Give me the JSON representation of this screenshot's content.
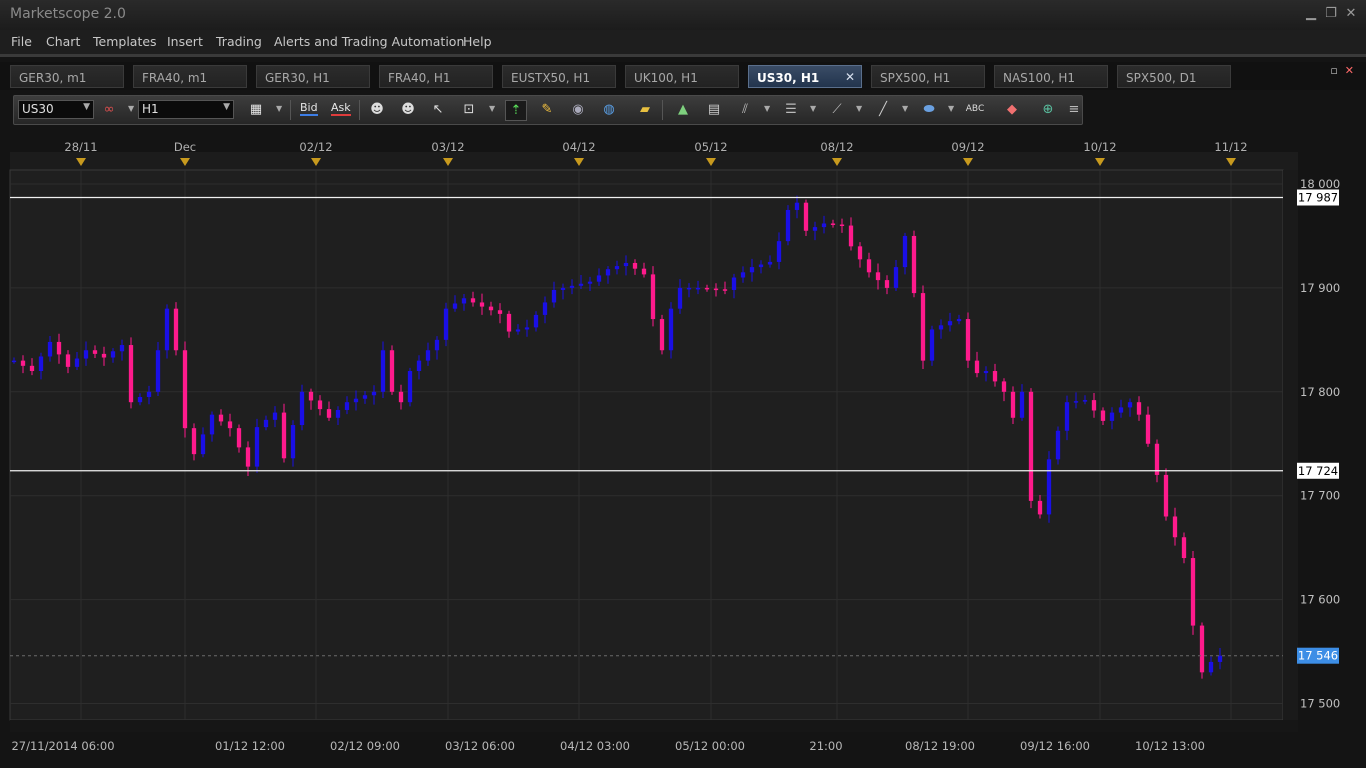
{
  "app": {
    "title": "Marketscope 2.0"
  },
  "window_controls": {
    "minimize": "▁",
    "restore": "❐",
    "close": "✕"
  },
  "menu": [
    "File",
    "Chart",
    "Templates",
    "Insert",
    "Trading",
    "Alerts and Trading Automation",
    "Help"
  ],
  "tabs": [
    {
      "label": "GER30, m1",
      "active": false
    },
    {
      "label": "FRA40, m1",
      "active": false
    },
    {
      "label": "GER30, H1",
      "active": false
    },
    {
      "label": "FRA40, H1",
      "active": false
    },
    {
      "label": "EUSTX50, H1",
      "active": false
    },
    {
      "label": "UK100, H1",
      "active": false
    },
    {
      "label": "US30, H1",
      "active": true
    },
    {
      "label": "SPX500, H1",
      "active": false
    },
    {
      "label": "NAS100, H1",
      "active": false
    },
    {
      "label": "SPX500, D1",
      "active": false
    }
  ],
  "tab_close_glyph": "✕",
  "panel_controls": {
    "maximize": "▫",
    "close": "✕"
  },
  "toolbar": {
    "symbol": "US30",
    "timeframe": "H1",
    "bid_label": "Bid",
    "ask_label": "Ask",
    "icons": [
      "link-icon",
      "candle-type-icon",
      "crosshair-icon",
      "eye-icon",
      "globe-icon",
      "ruler-icon",
      "drawing-icon",
      "chart-window-icon",
      "fibonacci-icon",
      "channel-icon",
      "trendline-icon",
      "line-tool-icon",
      "ellipse-icon",
      "text-tool-icon",
      "eraser-icon",
      "network-icon",
      "list-icon"
    ]
  },
  "colors": {
    "bull_candle": "#1a0fe6",
    "bear_candle": "#ff1a8c",
    "current_price_tag": "#3d8ee6",
    "background": "#1f1f1f"
  },
  "chart_data": {
    "type": "candlestick",
    "instrument": "US30",
    "timeframe": "H1",
    "top_axis_labels": [
      "28/11",
      "Dec",
      "02/12",
      "03/12",
      "04/12",
      "05/12",
      "08/12",
      "09/12",
      "10/12",
      "11/12"
    ],
    "bottom_axis_labels": [
      "27/11/2014 06:00",
      "01/12 12:00",
      "02/12 09:00",
      "03/12 06:00",
      "04/12 03:00",
      "05/12 00:00",
      "21:00",
      "08/12 19:00",
      "09/12 16:00",
      "10/12 13:00"
    ],
    "y_ticks": [
      {
        "value": 18000,
        "label": "18 000"
      },
      {
        "value": 17900,
        "label": "17 900"
      },
      {
        "value": 17800,
        "label": "17 800"
      },
      {
        "value": 17700,
        "label": "17 700"
      },
      {
        "value": 17600,
        "label": "17 600"
      },
      {
        "value": 17500,
        "label": "17 500"
      }
    ],
    "ylim": [
      17480,
      18015
    ],
    "horizontal_lines": [
      {
        "value": 17987,
        "label": "17 987"
      },
      {
        "value": 17724,
        "label": "17 724"
      }
    ],
    "current_price": {
      "value": 17546,
      "label": "17 546"
    },
    "price_path": [
      [
        0,
        17830
      ],
      [
        2,
        17820
      ],
      [
        4,
        17848
      ],
      [
        6,
        17824
      ],
      [
        8,
        17840
      ],
      [
        10,
        17833
      ],
      [
        12,
        17845
      ],
      [
        13,
        17790
      ],
      [
        15,
        17800
      ],
      [
        17,
        17880
      ],
      [
        18,
        17840
      ],
      [
        19,
        17765
      ],
      [
        20,
        17740
      ],
      [
        22,
        17778
      ],
      [
        24,
        17765
      ],
      [
        26,
        17728
      ],
      [
        27,
        17766
      ],
      [
        29,
        17780
      ],
      [
        30,
        17736
      ],
      [
        31,
        17768
      ],
      [
        32,
        17800
      ],
      [
        35,
        17775
      ],
      [
        37,
        17790
      ],
      [
        40,
        17800
      ],
      [
        41,
        17840
      ],
      [
        42,
        17800
      ],
      [
        43,
        17790
      ],
      [
        44,
        17820
      ],
      [
        45,
        17830
      ],
      [
        47,
        17850
      ],
      [
        48,
        17880
      ],
      [
        50,
        17890
      ],
      [
        52,
        17882
      ],
      [
        54,
        17875
      ],
      [
        55,
        17858
      ],
      [
        57,
        17862
      ],
      [
        60,
        17898
      ],
      [
        62,
        17902
      ],
      [
        64,
        17906
      ],
      [
        66,
        17918
      ],
      [
        68,
        17924
      ],
      [
        70,
        17913
      ],
      [
        71,
        17870
      ],
      [
        72,
        17840
      ],
      [
        73,
        17880
      ],
      [
        74,
        17900
      ],
      [
        76,
        17900
      ],
      [
        79,
        17898
      ],
      [
        80,
        17910
      ],
      [
        82,
        17920
      ],
      [
        84,
        17925
      ],
      [
        85,
        17945
      ],
      [
        86,
        17975
      ],
      [
        87,
        17982
      ],
      [
        88,
        17955
      ],
      [
        90,
        17962
      ],
      [
        92,
        17960
      ],
      [
        93,
        17940
      ],
      [
        95,
        17915
      ],
      [
        97,
        17900
      ],
      [
        98,
        17920
      ],
      [
        99,
        17950
      ],
      [
        100,
        17895
      ],
      [
        101,
        17830
      ],
      [
        102,
        17860
      ],
      [
        104,
        17868
      ],
      [
        105,
        17870
      ],
      [
        106,
        17830
      ],
      [
        107,
        17818
      ],
      [
        108,
        17820
      ],
      [
        110,
        17800
      ],
      [
        111,
        17775
      ],
      [
        112,
        17800
      ],
      [
        113,
        17695
      ],
      [
        114,
        17682
      ],
      [
        115,
        17735
      ],
      [
        117,
        17790
      ],
      [
        119,
        17792
      ],
      [
        121,
        17772
      ],
      [
        122,
        17780
      ],
      [
        124,
        17790
      ],
      [
        125,
        17778
      ],
      [
        126,
        17750
      ],
      [
        127,
        17720
      ],
      [
        128,
        17680
      ],
      [
        129,
        17660
      ],
      [
        130,
        17640
      ],
      [
        131,
        17575
      ],
      [
        132,
        17530
      ],
      [
        133,
        17540
      ],
      [
        134,
        17546
      ]
    ]
  }
}
